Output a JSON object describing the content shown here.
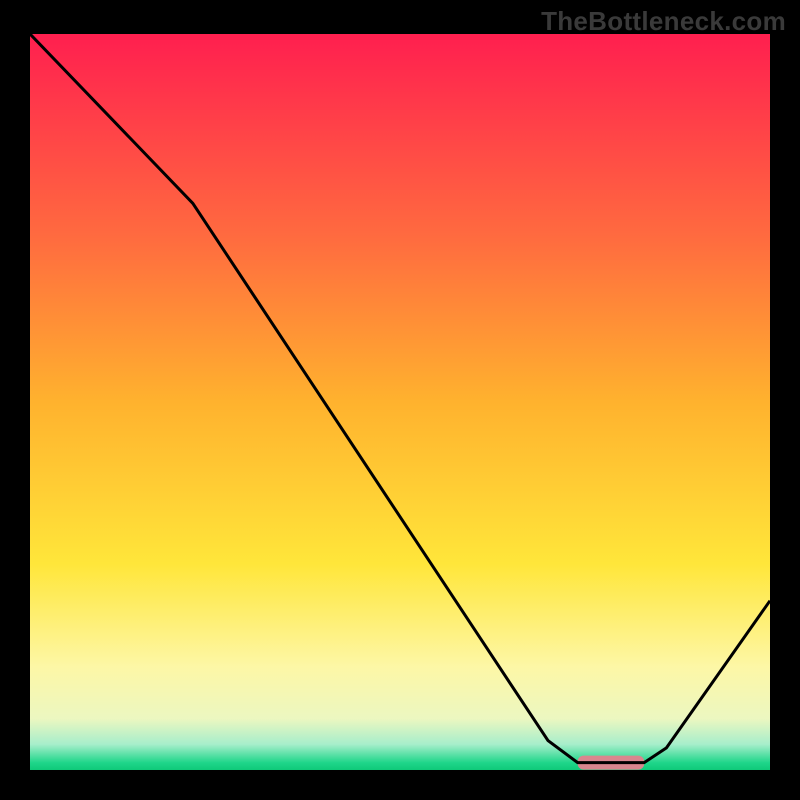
{
  "watermark": "TheBottleneck.com",
  "chart_data": {
    "type": "line",
    "title": "",
    "xlabel": "",
    "ylabel": "",
    "xlim": [
      0,
      100
    ],
    "ylim": [
      0,
      100
    ],
    "x": [
      0,
      22,
      70,
      74,
      83,
      86,
      100
    ],
    "values": [
      100,
      77,
      4,
      1,
      1,
      3,
      23
    ],
    "flat_region": {
      "x0": 74,
      "x1": 83,
      "y": 1
    },
    "flat_marker_color": "#d9868e",
    "curve_color": "#000000",
    "curve_width": 3,
    "background_gradient": {
      "stops": [
        {
          "pct": 0,
          "color": "#ff1f4f"
        },
        {
          "pct": 28,
          "color": "#ff6c3f"
        },
        {
          "pct": 50,
          "color": "#ffb22e"
        },
        {
          "pct": 72,
          "color": "#ffe63a"
        },
        {
          "pct": 86,
          "color": "#fdf7a6"
        },
        {
          "pct": 93,
          "color": "#ecf7c0"
        },
        {
          "pct": 96.5,
          "color": "#a7eecb"
        },
        {
          "pct": 99,
          "color": "#1fd68a"
        },
        {
          "pct": 100,
          "color": "#0fc979"
        }
      ]
    }
  }
}
